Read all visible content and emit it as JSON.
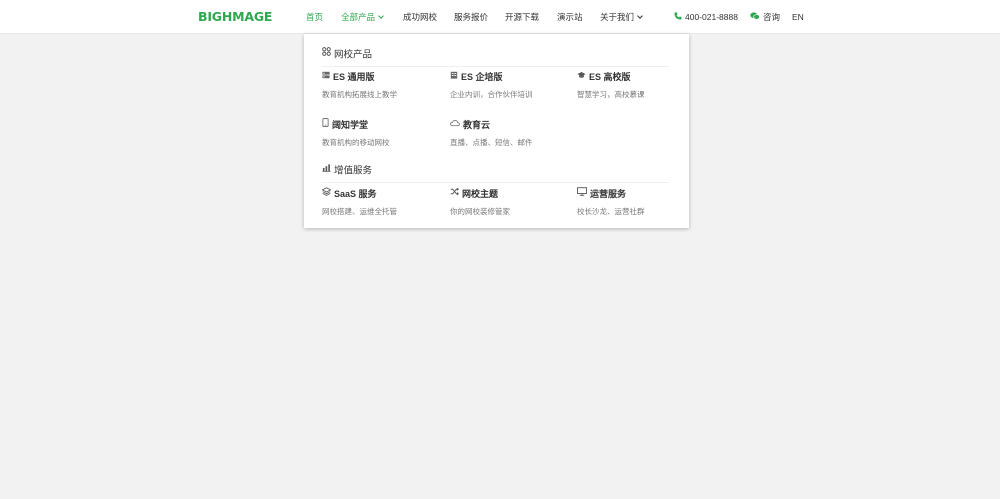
{
  "header": {
    "logo_text": "BIGHMAGE",
    "nav": [
      {
        "label": "首页",
        "active": true
      },
      {
        "label": "全部产品",
        "dropdown": true
      },
      {
        "label": "成功网校"
      },
      {
        "label": "服务报价"
      },
      {
        "label": "开源下载"
      },
      {
        "label": "演示站"
      },
      {
        "label": "关于我们",
        "dropdown": true
      }
    ],
    "phone": "400-021-8888",
    "consult": "咨询",
    "lang": "EN"
  },
  "dropdown": {
    "sections": [
      {
        "title": "网校产品",
        "icon": "grid-icon",
        "items": [
          {
            "title": "ES 通用版",
            "desc": "教育机构拓展线上教学",
            "icon": "server-icon"
          },
          {
            "title": "ES 企培版",
            "desc": "企业内训，合作伙伴培训",
            "icon": "building-icon"
          },
          {
            "title": "ES 高校版",
            "desc": "智慧学习，高校慕课",
            "icon": "graduation-cap-icon"
          },
          {
            "title": "阔知学堂",
            "desc": "教育机构的移动网校",
            "icon": "mobile-icon"
          },
          {
            "title": "教育云",
            "desc": "直播、点播、短信、邮件",
            "icon": "cloud-icon"
          }
        ]
      },
      {
        "title": "增值服务",
        "icon": "bar-chart-icon",
        "items": [
          {
            "title": "SaaS 服务",
            "desc": "网校搭建、运维全托管",
            "icon": "layers-icon"
          },
          {
            "title": "网校主题",
            "desc": "你的网校装修管家",
            "icon": "shuffle-icon"
          },
          {
            "title": "运营服务",
            "desc": "校长沙龙、运营社群",
            "icon": "monitor-icon"
          }
        ]
      }
    ]
  },
  "colors": {
    "accent": "#2ea84f",
    "background": "#f2f2f2"
  }
}
